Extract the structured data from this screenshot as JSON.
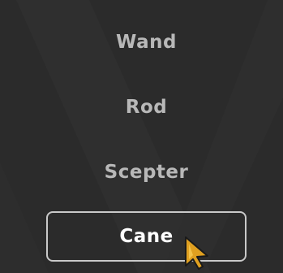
{
  "menu": {
    "options": [
      {
        "label": "Wand",
        "selected": false
      },
      {
        "label": "Rod",
        "selected": false
      },
      {
        "label": "Scepter",
        "selected": false
      },
      {
        "label": "Cane",
        "selected": true
      }
    ]
  },
  "colors": {
    "background": "#2b2b2b",
    "option_text": "#b8b8b8",
    "selected_text": "#ffffff",
    "selected_border": "#c9c9c9",
    "cursor_fill": "#e0a020"
  },
  "icons": {
    "cursor": "arrow-pointer-icon"
  }
}
